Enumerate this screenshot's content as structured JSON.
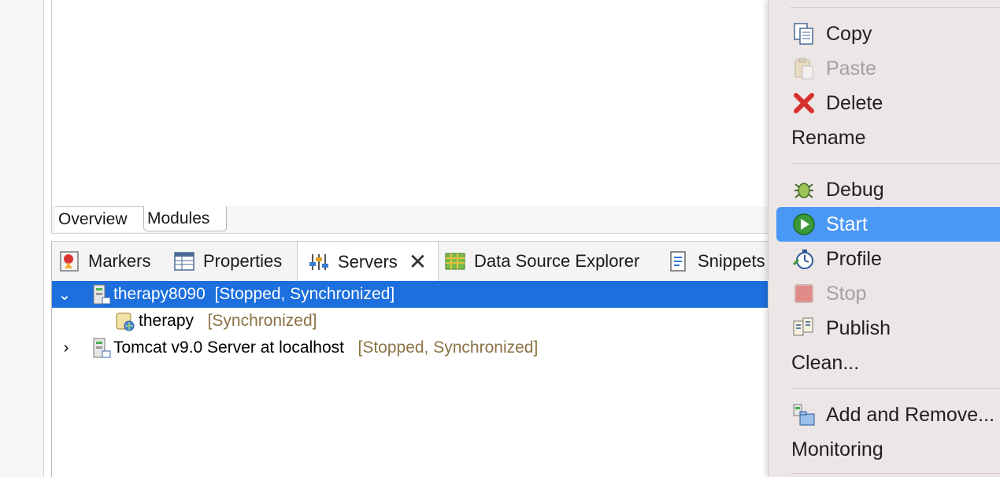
{
  "editor": {
    "tabs": [
      "Overview",
      "Modules"
    ]
  },
  "servers_view": {
    "tabs": [
      {
        "label": "Markers",
        "icon": "markers-icon"
      },
      {
        "label": "Properties",
        "icon": "properties-icon"
      },
      {
        "label": "Servers",
        "icon": "servers-icon",
        "active": true
      },
      {
        "label": "Data Source Explorer",
        "icon": "data-source-explorer-icon"
      },
      {
        "label": "Snippets",
        "icon": "snippets-icon"
      }
    ],
    "rows": [
      {
        "name": "therapy8090",
        "status": "[Stopped, Synchronized]",
        "expanded": true,
        "selected": true
      },
      {
        "name": "therapy",
        "status": "[Synchronized]"
      },
      {
        "name": "Tomcat v9.0 Server at localhost",
        "status": "[Stopped, Synchronized]",
        "expanded": false
      }
    ]
  },
  "context_menu": {
    "items": [
      {
        "label": "Copy",
        "icon": "copy-icon"
      },
      {
        "label": "Paste",
        "icon": "paste-icon",
        "disabled": true
      },
      {
        "label": "Delete",
        "icon": "delete-icon"
      },
      {
        "label": "Rename"
      },
      {
        "label": "Debug",
        "icon": "debug-icon"
      },
      {
        "label": "Start",
        "icon": "start-icon",
        "highlighted": true
      },
      {
        "label": "Profile",
        "icon": "profile-icon"
      },
      {
        "label": "Stop",
        "icon": "stop-icon",
        "disabled": true
      },
      {
        "label": "Publish",
        "icon": "publish-icon"
      },
      {
        "label": "Clean..."
      },
      {
        "label": "Add and Remove...",
        "icon": "add-remove-icon"
      },
      {
        "label": "Monitoring"
      }
    ]
  },
  "colors": {
    "selection": "#1c6fdc",
    "menu_highlight": "#4a98f5",
    "status_text": "#8b7244",
    "menu_background": "#ece6e6"
  }
}
